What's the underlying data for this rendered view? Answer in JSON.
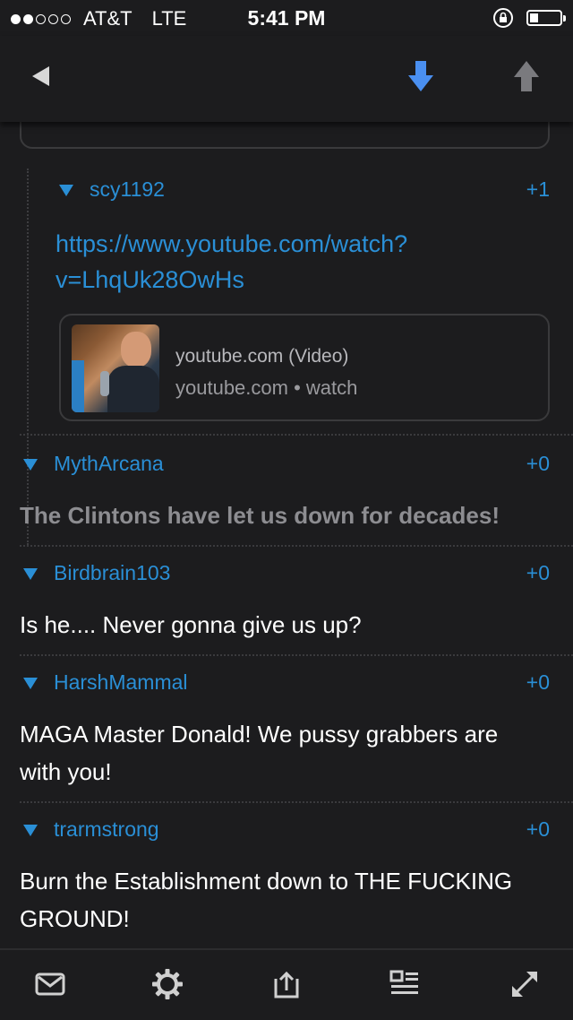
{
  "status_bar": {
    "carrier": "AT&T",
    "network": "LTE",
    "time": "5:41 PM",
    "signal_bars_filled": 2,
    "signal_bars_total": 5,
    "battery_level": 0.25
  },
  "nav": {
    "back_icon": "back-arrow-icon",
    "down_icon": "down-arrow-icon",
    "up_icon": "up-arrow-icon",
    "down_active_color": "#4a8ff0",
    "up_color": "#7a7a7e"
  },
  "comments": [
    {
      "username": "scy1192",
      "score": "+1",
      "link_line1": "https://www.youtube.com/watch?",
      "link_line2": "v=LhqUk28OwHs",
      "embed": {
        "title": "youtube.com (Video)",
        "subtitle": "youtube.com • watch"
      }
    },
    {
      "username": "MythArcana",
      "score": "+0",
      "body": "The Clintons have let us down for decades!"
    },
    {
      "username": "Birdbrain103",
      "score": "+0",
      "body": "Is he.... Never gonna give us up?"
    },
    {
      "username": "HarshMammal",
      "score": "+0",
      "body_line1": "MAGA Master Donald! We pussy grabbers are",
      "body_line2": "with you!"
    },
    {
      "username": "trarmstrong",
      "score": "+0",
      "body_line1": "Burn the Establishment down to THE FUCKING",
      "body_line2": "GROUND!"
    }
  ],
  "tabbar": {
    "items": [
      "mail-icon",
      "gear-icon",
      "share-icon",
      "article-view-icon",
      "expand-icon"
    ]
  },
  "colors": {
    "background": "#1c1c1e",
    "accent": "#2a8fd6",
    "text": "#ffffff",
    "muted": "#8d8d91"
  }
}
